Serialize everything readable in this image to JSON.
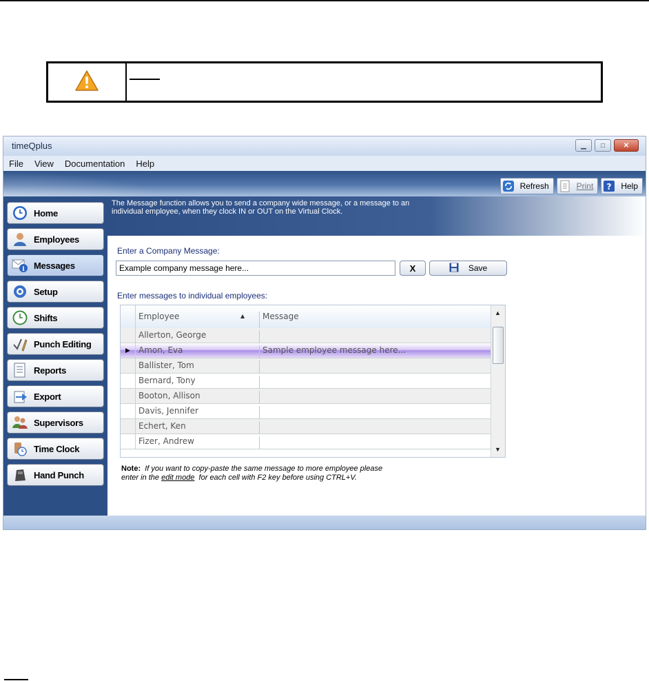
{
  "window": {
    "title": "timeQplus"
  },
  "menu": [
    "File",
    "View",
    "Documentation",
    "Help"
  ],
  "toolbar": {
    "refresh": "Refresh",
    "print": "Print",
    "help": "Help"
  },
  "sidebar": {
    "items": [
      {
        "label": "Home",
        "icon": "clock-icon"
      },
      {
        "label": "Employees",
        "icon": "employee-icon"
      },
      {
        "label": "Messages",
        "icon": "envelope-info-icon",
        "active": true
      },
      {
        "label": "Setup",
        "icon": "setup-icon"
      },
      {
        "label": "Shifts",
        "icon": "shift-clock-icon"
      },
      {
        "label": "Punch Editing",
        "icon": "check-pencil-icon"
      },
      {
        "label": "Reports",
        "icon": "document-icon"
      },
      {
        "label": "Export",
        "icon": "export-arrow-icon"
      },
      {
        "label": "Supervisors",
        "icon": "supervisors-icon"
      },
      {
        "label": "Time Clock",
        "icon": "time-clock-icon"
      },
      {
        "label": "Hand Punch",
        "icon": "hand-punch-icon"
      }
    ]
  },
  "info": {
    "text": "The Message function allows you to send a company wide message, or a message to an individual employee, when they clock IN or OUT on the Virtual Clock."
  },
  "company": {
    "label": "Enter a Company Message:",
    "value": "Example company message here...",
    "clear": "X",
    "save": "Save"
  },
  "individual": {
    "label": "Enter messages to individual employees:"
  },
  "grid": {
    "columns": [
      "Employee",
      "Message"
    ],
    "rows": [
      {
        "employee": "Allerton, George",
        "message": ""
      },
      {
        "employee": "Amon, Eva",
        "message": "Sample employee message here...",
        "selected": true
      },
      {
        "employee": "Ballister, Tom",
        "message": ""
      },
      {
        "employee": "Bernard, Tony",
        "message": ""
      },
      {
        "employee": "Booton, Allison",
        "message": ""
      },
      {
        "employee": "Davis, Jennifer",
        "message": ""
      },
      {
        "employee": "Echert, Ken",
        "message": ""
      },
      {
        "employee": "Fizer, Andrew",
        "message": ""
      }
    ]
  },
  "note": {
    "bold": "Note:",
    "line1": "If you want to copy-paste the same message to more employee please",
    "line2a": "enter in the",
    "line2u": "edit mode",
    "line2b": "for each cell with F2 key before using CTRL+V."
  },
  "colors": {
    "accent": "#2c4f86",
    "selected_row": "#a98ee6",
    "label": "#1a2e78"
  }
}
